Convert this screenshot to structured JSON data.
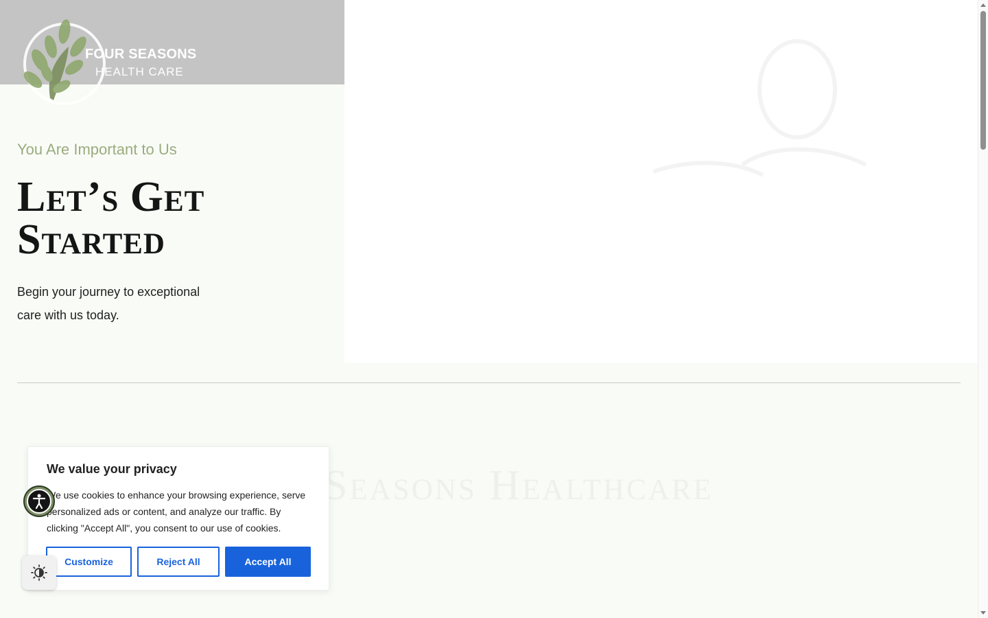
{
  "brand": {
    "name_line1": "FOUR SEASONS",
    "name_line2": "HEALTH CARE"
  },
  "hero": {
    "eyebrow": "You Are Important to Us",
    "headline": "Let’s Get Started",
    "intro": "Begin your journey to exceptional care with us today."
  },
  "faded_section": {
    "title": "Seasons Healthcare"
  },
  "cookie_banner": {
    "title": "We value your privacy",
    "text": "We use cookies to enhance your browsing experience, serve personalized ads or content, and analyze our traffic. By clicking \"Accept All\", you consent to our use of cookies.",
    "customize_label": "Customize",
    "reject_label": "Reject All",
    "accept_label": "Accept All"
  },
  "colors": {
    "accent_green": "#9bab7f",
    "cookie_blue": "#1863dc",
    "background": "#f9fcf6"
  },
  "icons": {
    "logo": "tree-logo-icon",
    "accessibility": "accessibility-person-icon",
    "contrast": "contrast-toggle-icon"
  }
}
